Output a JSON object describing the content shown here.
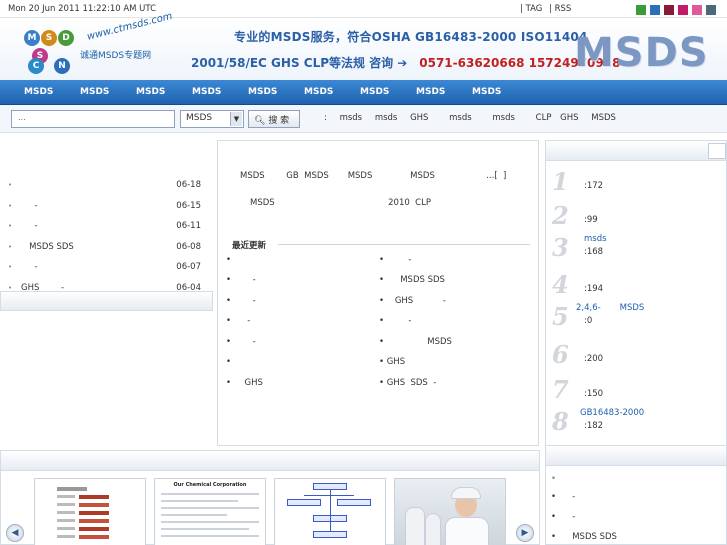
{
  "topbar": {
    "datetime": "Mon 20 Jun 2011 11:22:10 AM UTC",
    "tag": "| TAG",
    "rss": "| RSS",
    "swatches": [
      "#3b9b3b",
      "#2a6fb8",
      "#8a1a3a",
      "#c41a6a",
      "#e05a9a",
      "#4a6a7a"
    ]
  },
  "header": {
    "logo_letters": [
      "M",
      "S",
      "D",
      "S",
      "C",
      "N"
    ],
    "logo_url": "www.ctmsds.com",
    "logo_sub": "诚通MSDS专题网",
    "slogan_line1": "专业的MSDS服务，符合OSHA GB16483-2000 ISO11404",
    "slogan_line2": "2001/58/EC GHS CLP等法规 咨询",
    "phones": "0571-63620668 15724970928",
    "brand": "MSDS"
  },
  "nav": {
    "items": [
      "MSDS",
      "MSDS",
      "MSDS",
      "MSDS",
      "MSDS",
      "MSDS",
      "MSDS",
      "MSDS",
      "MSDS"
    ]
  },
  "search": {
    "placeholder": "...",
    "select_value": "MSDS",
    "button_label": "搜 索",
    "hot_prefix": ":",
    "hot_terms": [
      "msds",
      "msds",
      "GHS",
      "msds",
      "msds",
      "CLP",
      "GHS",
      "MSDS"
    ]
  },
  "intro": {
    "line1": "MSDS        GB  MSDS       MSDS              MSDS                   ...[  ]",
    "line2": "MSDS                                          2010  CLP"
  },
  "latest": {
    "title": "最近更新",
    "left_items": [
      "•",
      "•        -",
      "•        -",
      "•      -",
      "•        -",
      "•",
      "•     GHS"
    ],
    "right_items": [
      "•         -",
      "•      MSDS SDS",
      "•    GHS           -",
      "•         -",
      "•                MSDS",
      "• GHS",
      "• GHS  SDS  -"
    ]
  },
  "left_list": [
    {
      "title": "",
      "date": "06-18"
    },
    {
      "title": "     -",
      "date": "06-15"
    },
    {
      "title": "     -",
      "date": "06-11"
    },
    {
      "title": "   MSDS SDS",
      "date": "06-08"
    },
    {
      "title": "     -",
      "date": "06-07"
    },
    {
      "title": "GHS        -",
      "date": "06-04"
    }
  ],
  "ranking": [
    {
      "num": "1",
      "title": "",
      "count": ":172"
    },
    {
      "num": "2",
      "title": "",
      "count": ":99"
    },
    {
      "num": "3",
      "title": "msds",
      "count": ":168"
    },
    {
      "num": "4",
      "title": "",
      "count": ":194"
    },
    {
      "num": "5",
      "title": "2,4,6-       MSDS",
      "count": ":0"
    },
    {
      "num": "6",
      "title": "",
      "count": ":200"
    },
    {
      "num": "7",
      "title": "",
      "count": ":150"
    },
    {
      "num": "8",
      "title": "GB16483-2000",
      "count": ":182"
    }
  ],
  "bottom_right_list": [
    "•",
    "•      -",
    "•      -",
    "•      MSDS SDS"
  ],
  "thumbs": {
    "doc2_title": "Our Chemical Corporation"
  },
  "colors": {
    "nav_blue": "#2a72c2",
    "link_blue": "#1d5fae",
    "accent_red": "#c02020"
  }
}
